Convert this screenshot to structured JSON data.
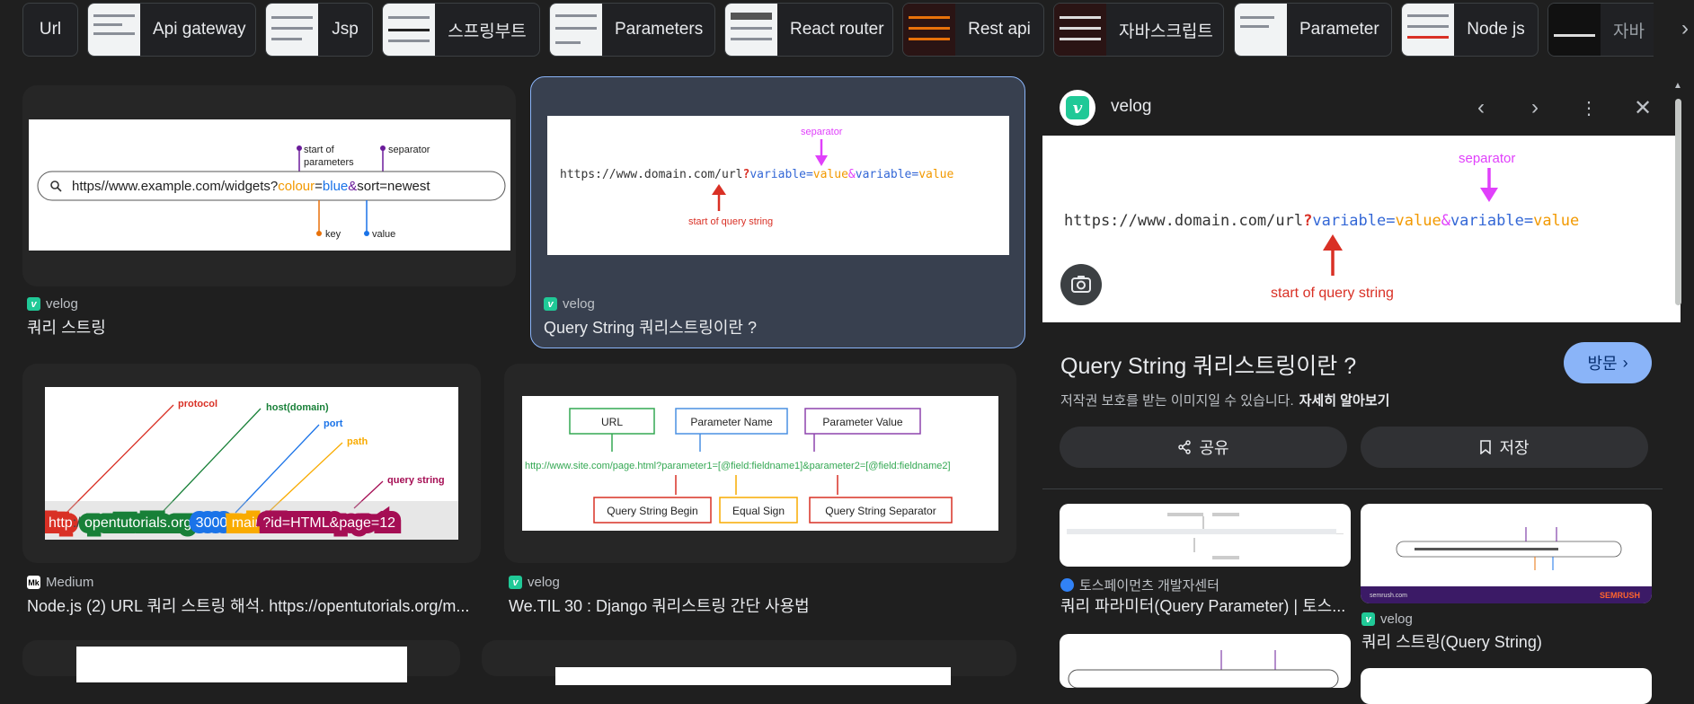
{
  "chips": [
    "Url",
    "Api gateway",
    "Jsp",
    "스프링부트",
    "Parameters",
    "React router",
    "Rest api",
    "자바스크립트",
    "Parameter",
    "Node js",
    "자바"
  ],
  "results": [
    {
      "source": "velog",
      "title": "쿼리 스트링",
      "favicon": "v"
    },
    {
      "source": "velog",
      "title": "Query String 쿼리스트링이란 ?",
      "favicon": "v"
    },
    {
      "source": "Medium",
      "title": "Node.js (2) URL 쿼리 스트링 해석. https://opentutorials.org/m...",
      "favicon": "Mk"
    },
    {
      "source": "velog",
      "title": "We.TIL 30 : Django 쿼리스트링 간단 사용법",
      "favicon": "v"
    }
  ],
  "img1": {
    "url": "https//www.example.com/widgets?",
    "k": "colour",
    "eq": "=",
    "v": "blue",
    "amp": "&",
    "rest": "sort=newest",
    "start": "start of",
    "params": "parameters",
    "sep": "separator",
    "key": "key",
    "value": "value"
  },
  "img2": {
    "base": "https://www.domain.com/url",
    "q": "?",
    "var": "variable",
    "eq": "=",
    "val": "value",
    "amp": "&",
    "sep": "separator",
    "start": "start of query string"
  },
  "img3": {
    "protocol": "protocol",
    "host": "host(domain)",
    "port": "port",
    "path": "path",
    "qs": "query string",
    "p1": "http",
    "p2": "://",
    "p3": "opentutorials.org",
    "p4": ":",
    "p5": "3000",
    "p6": "/",
    "p7": "main",
    "p8": "?id=HTML&page=12"
  },
  "img4": {
    "url": "URL",
    "pname": "Parameter Name",
    "pvalue": "Parameter Value",
    "line": "http://www.site.com/page.html?parameter1=[@field:fieldname1]&parameter2=[@field:fieldname2]",
    "begin": "Query String Begin",
    "eqsign": "Equal Sign",
    "qsep": "Query String Separator"
  },
  "panel": {
    "site": "velog",
    "title": "Query String 쿼리스트링이란 ?",
    "visit": "방문",
    "copyright": "저작권 보호를 받는 이미지일 수 있습니다.",
    "learn_more": "자세히 알아보기",
    "share": "공유",
    "save": "저장",
    "related": [
      {
        "source": "토스페이먼츠 개발자센터",
        "title": "쿼리 파라미터(Query Parameter) | 토스..."
      },
      {
        "source": "velog",
        "title": "쿼리 스트링(Query String)"
      }
    ],
    "rel2_brand": "SEMRUSH",
    "rel2_site": "semrush.com"
  },
  "colors": {
    "accent": "#8ab4f8",
    "velog": "#20c997",
    "selected_bg": "#38404f"
  }
}
